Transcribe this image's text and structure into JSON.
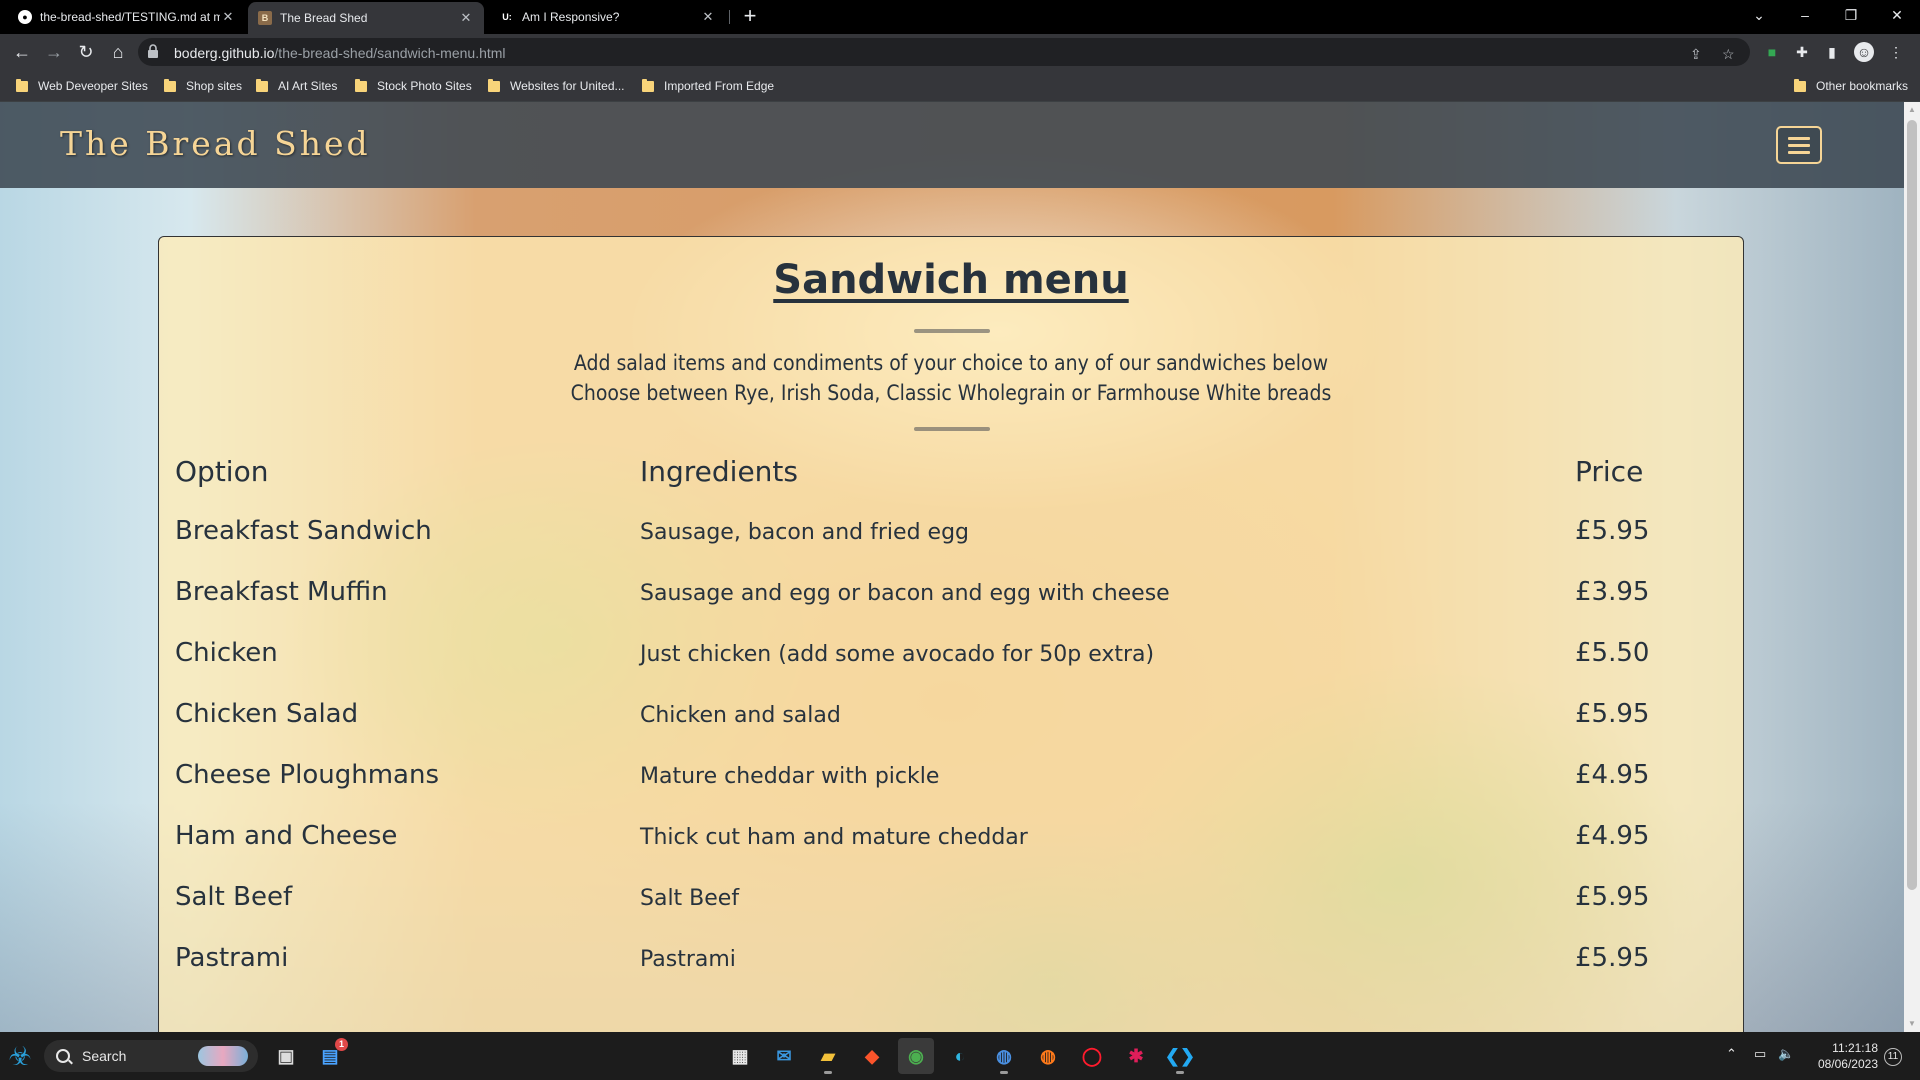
{
  "browser": {
    "tabs": [
      {
        "title": "the-bread-shed/TESTING.md at m",
        "icon": "github-icon"
      },
      {
        "title": "The Bread Shed",
        "icon": "bread-shed-favicon"
      },
      {
        "title": "Am I Responsive?",
        "icon": "amiresponsive-favicon"
      }
    ],
    "url_host": "boderg.github.io",
    "url_path": "/the-bread-shed/sandwich-menu.html",
    "bookmarks": [
      "Web Deveoper Sites",
      "Shop sites",
      "AI Art Sites",
      "Stock Photo Sites",
      "Websites for United...",
      "Imported From Edge"
    ],
    "other_bookmarks": "Other bookmarks"
  },
  "site": {
    "brand": "The Bread Shed",
    "menu_title": "Sandwich menu",
    "intro_line1": "Add salad items and condiments of your choice to any of our sandwiches below",
    "intro_line2": "Choose between Rye, Irish Soda, Classic Wholegrain or Farmhouse White breads",
    "columns": {
      "option": "Option",
      "ingredients": "Ingredients",
      "price": "Price"
    },
    "items": [
      {
        "option": "Breakfast Sandwich",
        "ingredients": "Sausage, bacon and fried egg",
        "price": "£5.95"
      },
      {
        "option": "Breakfast Muffin",
        "ingredients": "Sausage and egg or bacon and egg with cheese",
        "price": "£3.95"
      },
      {
        "option": "Chicken",
        "ingredients": "Just chicken (add some avocado for 50p extra)",
        "price": "£5.50"
      },
      {
        "option": "Chicken Salad",
        "ingredients": "Chicken and salad",
        "price": "£5.95"
      },
      {
        "option": "Cheese Ploughmans",
        "ingredients": "Mature cheddar with pickle",
        "price": "£4.95"
      },
      {
        "option": "Ham and Cheese",
        "ingredients": "Thick cut ham and mature cheddar",
        "price": "£4.95"
      },
      {
        "option": "Salt Beef",
        "ingredients": "Salt Beef",
        "price": "£5.95"
      },
      {
        "option": "Pastrami",
        "ingredients": "Pastrami",
        "price": "£5.95"
      }
    ]
  },
  "taskbar": {
    "search_label": "Search",
    "time": "11:21:18",
    "date": "08/06/2023",
    "notification_count": "11",
    "store_badge": "1"
  },
  "colors": {
    "brand_gold": "#f6d596",
    "panel": "#ffecb6",
    "text_dark": "#27323d",
    "header_bg": "#3c4852"
  }
}
